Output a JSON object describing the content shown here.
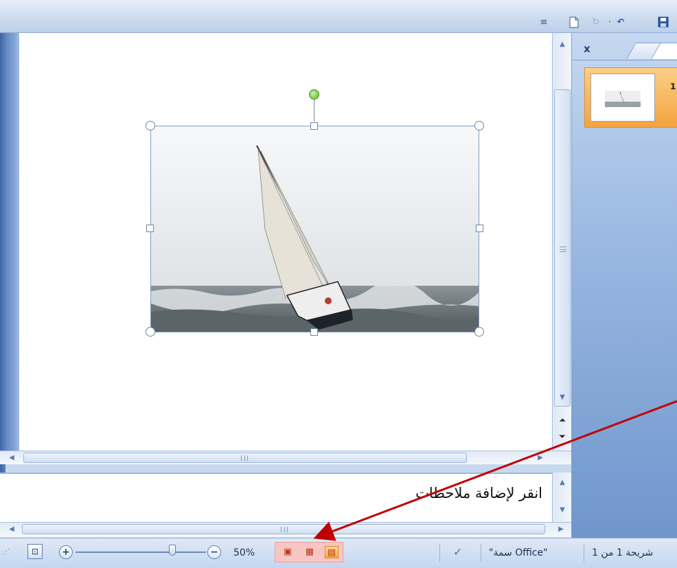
{
  "toolbar": {
    "icons": [
      "customize-icon",
      "new-icon",
      "redo-icon",
      "undo-icon",
      "save-icon"
    ],
    "customize_glyph": "≡",
    "redo_glyph": "↻",
    "undo_glyph": "↶",
    "sep_glyph": "·"
  },
  "panel": {
    "close_label": "x",
    "slide_number": "1"
  },
  "notes": {
    "placeholder": "انقر لإضافة ملاحظات"
  },
  "statusbar": {
    "slide_info": "شريحة 1 من 1",
    "theme": "\"سمة Office\"",
    "zoom_level": "50%",
    "zoom_in": "+",
    "zoom_out": "−",
    "fit_glyph": "⊡",
    "spell_glyph": "✓",
    "dots": "⋰"
  },
  "scroll": {
    "up": "▲",
    "down": "▼",
    "left": "◀",
    "right": "▶",
    "prev_slide": "⏶",
    "next_slide": "⏷"
  },
  "views": {
    "normal_glyph": "▤",
    "sorter_glyph": "▦",
    "show_glyph": "▣",
    "active": "normal"
  },
  "colors": {
    "accent_orange": "#f4a340",
    "highlight_red": "#c00000"
  }
}
